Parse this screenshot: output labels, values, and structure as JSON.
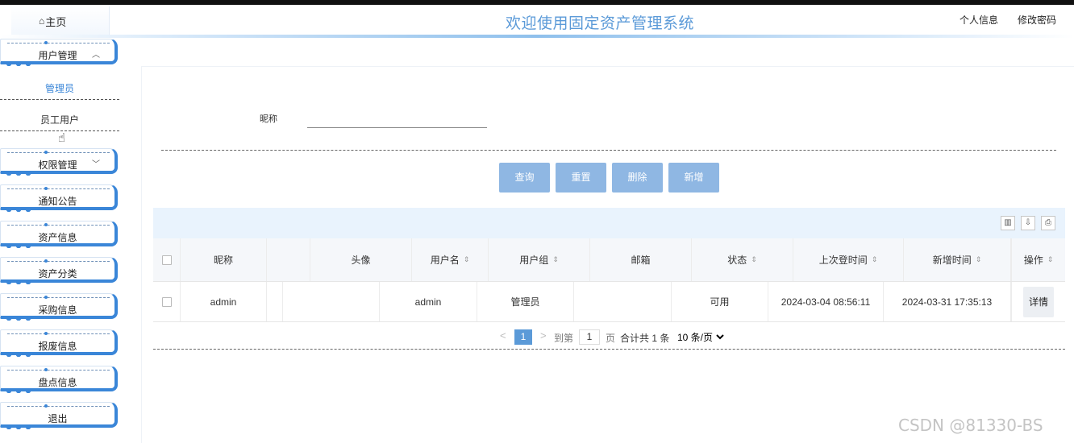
{
  "header": {
    "home_label": "主页",
    "title": "欢迎使用固定资产管理系统",
    "profile_label": "个人信息",
    "change_password_label": "修改密码"
  },
  "sidebar": {
    "user_mgmt": {
      "label": "用户管理",
      "chevron": "^",
      "children": [
        "管理员",
        "员工用户"
      ]
    },
    "permission_mgmt": {
      "label": "权限管理",
      "chevron": "v"
    },
    "items": [
      "通知公告",
      "资产信息",
      "资产分类",
      "采购信息",
      "报废信息",
      "盘点信息",
      "退出"
    ]
  },
  "search": {
    "label": "昵称",
    "value": ""
  },
  "buttons": {
    "query": "查询",
    "reset": "重置",
    "delete": "删除",
    "add": "新增"
  },
  "table": {
    "columns": [
      "昵称",
      "头像",
      "用户名",
      "用户组",
      "邮箱",
      "状态",
      "上次登时间",
      "新增时间",
      "操作"
    ],
    "sortable": [
      false,
      false,
      true,
      true,
      false,
      true,
      true,
      true,
      true
    ],
    "rows": [
      {
        "nickname": "admin",
        "avatar": "",
        "username": "admin",
        "group": "管理员",
        "email": "",
        "status": "可用",
        "last_login": "2024-03-04 08:56:11",
        "created": "2024-03-31 17:35:13",
        "action": "详情"
      }
    ]
  },
  "pager": {
    "prev": "<",
    "current_page": "1",
    "next": ">",
    "goto_label": "到第",
    "goto_value": "1",
    "page_unit": "页",
    "total_label": "合计共 1 条",
    "page_size_option": "10 条/页"
  },
  "watermark": "CSDN @81330-BS",
  "colors": {
    "accent": "#5b9ad8",
    "button": "#8fb7e3",
    "sidebar_border": "#3a86d8",
    "toolbar_bg": "#e9f3fd"
  }
}
